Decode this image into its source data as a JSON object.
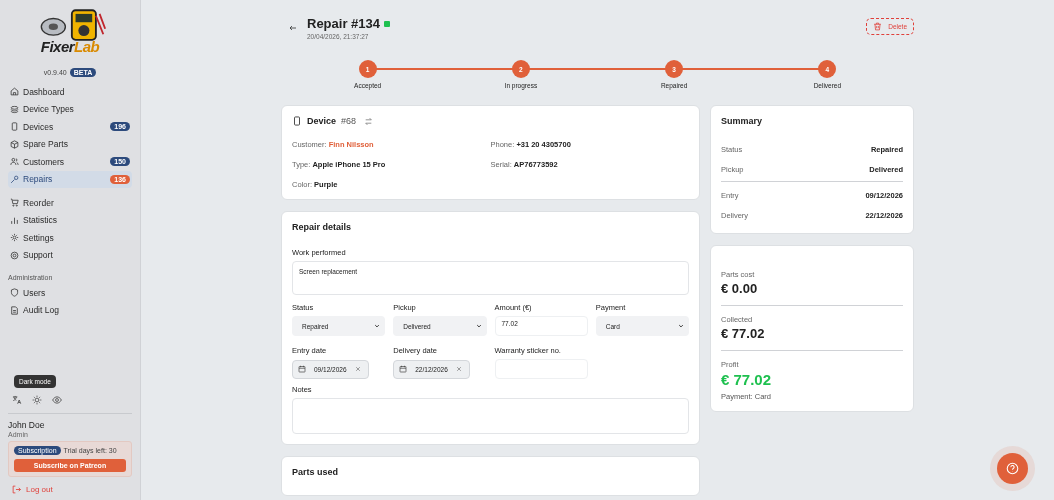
{
  "sidebar": {
    "logo_text": "FixerLab",
    "version": "v0.9.40",
    "version_badge": "BETA",
    "nav_groups": [
      {
        "items": [
          {
            "label": "Dashboard",
            "selected": false
          },
          {
            "label": "Device Types",
            "selected": false
          },
          {
            "label": "Devices",
            "badge": "196",
            "selected": false
          },
          {
            "label": "Spare Parts",
            "selected": false
          },
          {
            "label": "Customers",
            "badge": "150",
            "selected": false
          },
          {
            "label": "Repairs",
            "badge": "136",
            "selected": true
          }
        ]
      },
      {
        "items": [
          {
            "label": "Reorder",
            "selected": false
          },
          {
            "label": "Statistics",
            "selected": false
          },
          {
            "label": "Settings",
            "selected": false
          },
          {
            "label": "Support",
            "selected": false
          }
        ]
      },
      {
        "heading": "Administration",
        "items": [
          {
            "label": "Users",
            "selected": false
          },
          {
            "label": "Audit Log",
            "selected": false
          }
        ]
      }
    ],
    "tooltip": "Dark mode",
    "user": {
      "name": "John Doe",
      "role": "Admin"
    },
    "subscription": {
      "badge": "Subscription",
      "trial": "Trial days left: 30",
      "button": "Subscribe on Patreon"
    },
    "logout": "Log out"
  },
  "header": {
    "title": "Repair #134",
    "timestamp": "20/04/2026, 21:37:27",
    "delete": "Delete"
  },
  "steps": [
    {
      "number": "1",
      "label": "Accepted",
      "done": true
    },
    {
      "number": "2",
      "label": "In progress",
      "done": true
    },
    {
      "number": "3",
      "label": "Repaired",
      "done": true
    },
    {
      "number": "4",
      "label": "Delivered",
      "done": true
    }
  ],
  "device": {
    "title": "Device",
    "number": "#68",
    "fields": [
      {
        "label": "Customer:",
        "value": "Finn Nilsson",
        "kind": "link"
      },
      {
        "label": "Phone:",
        "value": "+31 20 4305700",
        "kind": "text"
      },
      {
        "label": "Type:",
        "value": "Apple iPhone 15 Pro",
        "kind": "text"
      },
      {
        "label": "Serial:",
        "value": "AP76773592",
        "kind": "text"
      },
      {
        "label": "Color:",
        "value": "Purple",
        "kind": "text"
      }
    ]
  },
  "repair_details": {
    "title": "Repair details",
    "work_performed": {
      "label": "Work performed",
      "value": "Screen replacement"
    },
    "fields": [
      {
        "kind": "select",
        "label": "Status",
        "value": "Repaired"
      },
      {
        "kind": "select",
        "label": "Pickup",
        "value": "Delivered"
      },
      {
        "kind": "input",
        "label": "Amount (€)",
        "value": "77.02"
      },
      {
        "kind": "select",
        "label": "Payment",
        "value": "Card"
      },
      {
        "kind": "date",
        "label": "Entry date",
        "value": "09/12/2026"
      },
      {
        "kind": "date",
        "label": "Delivery date",
        "value": "22/12/2026"
      },
      {
        "kind": "input",
        "label": "Warranty sticker no."
      }
    ],
    "notes": {
      "label": "Notes"
    }
  },
  "parts_used": {
    "title": "Parts used"
  },
  "summary": {
    "title": "Summary",
    "groups": [
      [
        {
          "label": "Status",
          "value": "Repaired"
        },
        {
          "label": "Pickup",
          "value": "Delivered"
        }
      ],
      [
        {
          "label": "Entry",
          "value": "09/12/2026"
        },
        {
          "label": "Delivery",
          "value": "22/12/2026"
        }
      ]
    ]
  },
  "totals": [
    {
      "label": "Parts cost",
      "value": "€ 0.00",
      "kind": "plain"
    },
    {
      "label": "Collected",
      "value": "€ 77.02",
      "kind": "plain"
    },
    {
      "label": "Profit",
      "value": "€ 77.02",
      "kind": "profit",
      "note": "Payment: Card"
    }
  ]
}
